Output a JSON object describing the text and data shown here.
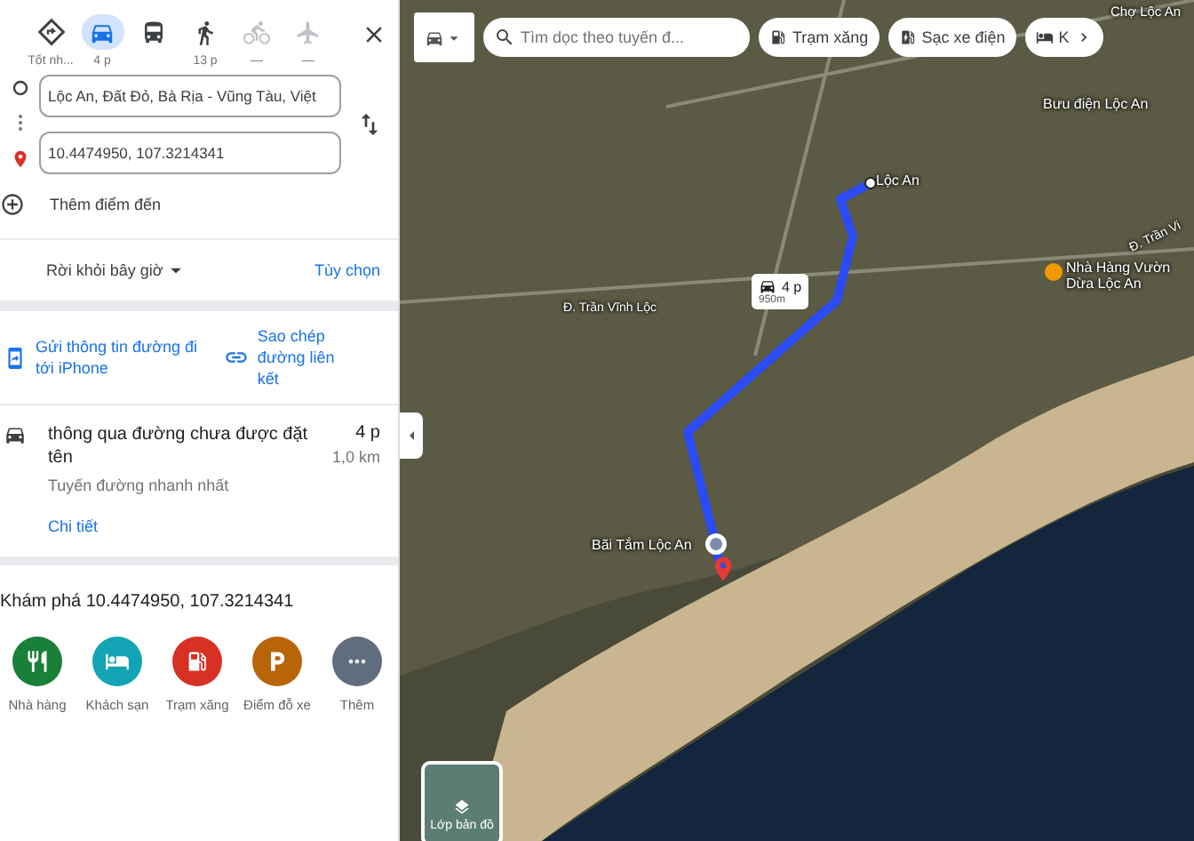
{
  "travel_modes": [
    {
      "kind": "best",
      "label": "Tốt nh...",
      "selected": false,
      "disabled": false
    },
    {
      "kind": "car",
      "label": "4 p",
      "selected": true,
      "disabled": false
    },
    {
      "kind": "transit",
      "selected": false,
      "disabled": false
    },
    {
      "kind": "walk",
      "label": "13 p",
      "selected": false,
      "disabled": false
    },
    {
      "kind": "bike",
      "label": "—",
      "selected": false,
      "disabled": true
    },
    {
      "kind": "flight",
      "label": "—",
      "selected": false,
      "disabled": true
    }
  ],
  "origin": {
    "value": "Lộc An, Đất Đỏ, Bà Rịa - Vũng Tàu, Việt"
  },
  "destination": {
    "value": "10.4474950, 107.3214341"
  },
  "add_destination": "Thêm điểm đến",
  "depart": {
    "label": "Rời khỏi bây giờ",
    "options": "Tùy chọn"
  },
  "share": {
    "send": "Gửi thông tin đường đi tới iPhone",
    "copy": "Sao chép đường liên kết"
  },
  "route": {
    "via": "thông qua đường chưa được đặt tên",
    "duration": "4 p",
    "distance": "1,0 km",
    "note": "Tuyến đường nhanh nhất",
    "details": "Chi tiết"
  },
  "explore": {
    "title": "Khám phá 10.4474950, 107.3214341",
    "categories": [
      {
        "kind": "restaurant",
        "label": "Nhà hàng",
        "color": "#188038"
      },
      {
        "kind": "hotel",
        "label": "Khách sạn",
        "color": "#12a4b4"
      },
      {
        "kind": "gas",
        "label": "Trạm xăng",
        "color": "#d93025"
      },
      {
        "kind": "parking",
        "label": "Điểm đỗ xe",
        "color": "#b8650a"
      },
      {
        "kind": "more",
        "label": "Thêm",
        "color": "#5f6d7e"
      }
    ]
  },
  "map": {
    "search": {
      "placeholder": "Tìm dọc theo tuyến đ..."
    },
    "chips": [
      {
        "kind": "gas",
        "label": "Trạm xăng"
      },
      {
        "kind": "charging",
        "label": "Sạc xe điện"
      },
      {
        "kind": "hotel",
        "label": "K"
      }
    ],
    "labels": [
      {
        "kind": "place",
        "text": "Chợ Lộc An"
      },
      {
        "kind": "place",
        "text": "Bưu điện Lộc An"
      },
      {
        "kind": "place",
        "text": "Lộc An"
      },
      {
        "kind": "road",
        "text": "Đ. Trần Vĩnh Lộc"
      },
      {
        "kind": "road",
        "text": "Đ. Trần Vi"
      },
      {
        "kind": "restaurant",
        "text": "Nhà Hàng Vườn Dừa Lộc An"
      },
      {
        "kind": "place",
        "text": "Bãi Tắm Lộc An"
      }
    ],
    "route_badge": {
      "duration": "4 p",
      "distance": "950m"
    },
    "layers": "Lớp bản đồ"
  }
}
